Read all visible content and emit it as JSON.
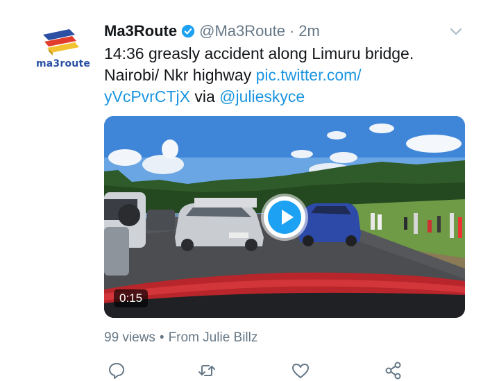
{
  "account": {
    "display_name": "Ma3Route",
    "handle": "@Ma3Route",
    "separator": "·",
    "time": "2m",
    "logo_text": "ma3route"
  },
  "tweet": {
    "line1": "14:36 greasly accident along Limuru bridge.",
    "line2_text": "Nairobi/ Nkr highway ",
    "line2_link": "pic.twitter.com/",
    "line3_link": "yVcPvrCTjX",
    "line3_via": " via ",
    "line3_mention": "@julieskyce"
  },
  "media": {
    "duration": "0:15"
  },
  "meta": {
    "views": "99 views",
    "separator": "•",
    "source": "From Julie Billz"
  },
  "icons": {
    "reply": "reply-icon",
    "retweet": "retweet-icon",
    "like": "heart-icon",
    "share": "share-icon",
    "verified": "verified-badge-icon",
    "menu": "chevron-down-icon",
    "play": "play-icon"
  },
  "colors": {
    "link": "#1b95e0",
    "verified": "#1da1f2",
    "secondary_text": "#657786",
    "primary_text": "#14171a",
    "play_button": "#1da1f2"
  }
}
